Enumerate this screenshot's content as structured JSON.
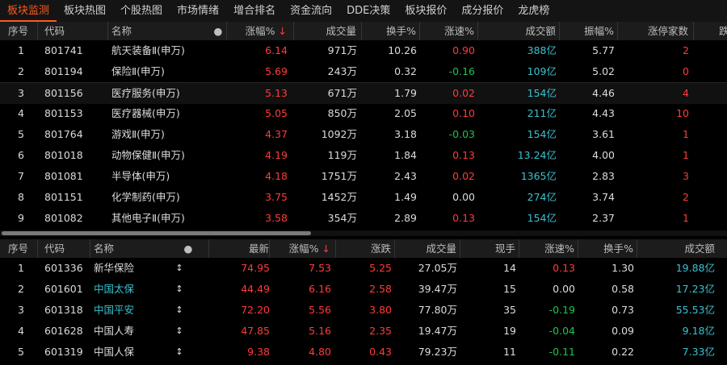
{
  "tabs": [
    {
      "label": "板块监测",
      "active": true
    },
    {
      "label": "板块热图",
      "active": false
    },
    {
      "label": "个股热图",
      "active": false
    },
    {
      "label": "市场情绪",
      "active": false
    },
    {
      "label": "增合排名",
      "active": false
    },
    {
      "label": "资金流向",
      "active": false
    },
    {
      "label": "DDE决策",
      "active": false
    },
    {
      "label": "板块报价",
      "active": false
    },
    {
      "label": "成分报价",
      "active": false
    },
    {
      "label": "龙虎榜",
      "active": false
    }
  ],
  "sector_table": {
    "headers": {
      "no": "序号",
      "code": "代码",
      "name": "名称",
      "change_pct": "涨幅%",
      "sort_arrow": "↓",
      "volume": "成交量",
      "turnover": "换手%",
      "speed": "涨速%",
      "amount": "成交额",
      "amplitude": "振幅%",
      "limit_up": "涨停家数",
      "cut": "跌"
    },
    "rows": [
      {
        "no": "1",
        "code": "801741",
        "name": "航天装备Ⅱ(申万)",
        "change": "6.14",
        "volume": "971万",
        "turnover": "10.26",
        "speed": "0.90",
        "speed_color": "red",
        "amount": "388亿",
        "amplitude": "5.77",
        "limit_up": "2"
      },
      {
        "no": "2",
        "code": "801194",
        "name": "保险Ⅱ(申万)",
        "change": "5.69",
        "volume": "243万",
        "turnover": "0.32",
        "speed": "-0.16",
        "speed_color": "green",
        "amount": "109亿",
        "amplitude": "5.02",
        "limit_up": "0"
      },
      {
        "no": "3",
        "code": "801156",
        "name": "医疗服务(申万)",
        "change": "5.13",
        "volume": "671万",
        "turnover": "1.79",
        "speed": "0.02",
        "speed_color": "red",
        "amount": "154亿",
        "amplitude": "4.46",
        "limit_up": "4"
      },
      {
        "no": "4",
        "code": "801153",
        "name": "医疗器械(申万)",
        "change": "5.05",
        "volume": "850万",
        "turnover": "2.05",
        "speed": "0.10",
        "speed_color": "red",
        "amount": "211亿",
        "amplitude": "4.43",
        "limit_up": "10"
      },
      {
        "no": "5",
        "code": "801764",
        "name": "游戏Ⅱ(申万)",
        "change": "4.37",
        "volume": "1092万",
        "turnover": "3.18",
        "speed": "-0.03",
        "speed_color": "green",
        "amount": "154亿",
        "amplitude": "3.61",
        "limit_up": "1"
      },
      {
        "no": "6",
        "code": "801018",
        "name": "动物保健Ⅱ(申万)",
        "change": "4.19",
        "volume": "119万",
        "turnover": "1.84",
        "speed": "0.13",
        "speed_color": "red",
        "amount": "13.24亿",
        "amplitude": "4.00",
        "limit_up": "1"
      },
      {
        "no": "7",
        "code": "801081",
        "name": "半导体(申万)",
        "change": "4.18",
        "volume": "1751万",
        "turnover": "2.43",
        "speed": "0.02",
        "speed_color": "red",
        "amount": "1365亿",
        "amplitude": "2.83",
        "limit_up": "3"
      },
      {
        "no": "8",
        "code": "801151",
        "name": "化学制药(申万)",
        "change": "3.75",
        "volume": "1452万",
        "turnover": "1.49",
        "speed": "0.00",
        "speed_color": "white",
        "amount": "274亿",
        "amplitude": "3.74",
        "limit_up": "2"
      },
      {
        "no": "9",
        "code": "801082",
        "name": "其他电子Ⅱ(申万)",
        "change": "3.58",
        "volume": "354万",
        "turnover": "2.89",
        "speed": "0.13",
        "speed_color": "red",
        "amount": "154亿",
        "amplitude": "2.37",
        "limit_up": "1"
      }
    ]
  },
  "stock_table": {
    "headers": {
      "no": "序号",
      "code": "代码",
      "name": "名称",
      "last": "最新",
      "change_pct": "涨幅%",
      "sort_arrow": "↓",
      "change": "涨跌",
      "volume": "成交量",
      "hand": "现手",
      "speed": "涨速%",
      "turnover": "换手%",
      "amount": "成交额"
    },
    "rows": [
      {
        "no": "1",
        "code": "601336",
        "name": "新华保险",
        "name_color": "white",
        "last": "74.95",
        "pct": "7.53",
        "chg": "5.25",
        "volume": "27.05万",
        "hand": "14",
        "speed": "0.13",
        "speed_color": "red",
        "turnover": "1.30",
        "amount": "19.88亿"
      },
      {
        "no": "2",
        "code": "601601",
        "name": "中国太保",
        "name_color": "cyan",
        "last": "44.49",
        "pct": "6.16",
        "chg": "2.58",
        "volume": "39.47万",
        "hand": "15",
        "speed": "0.00",
        "speed_color": "white",
        "turnover": "0.58",
        "amount": "17.23亿"
      },
      {
        "no": "3",
        "code": "601318",
        "name": "中国平安",
        "name_color": "cyan",
        "last": "72.20",
        "pct": "5.56",
        "chg": "3.80",
        "volume": "77.80万",
        "hand": "35",
        "speed": "-0.19",
        "speed_color": "green",
        "turnover": "0.73",
        "amount": "55.53亿"
      },
      {
        "no": "4",
        "code": "601628",
        "name": "中国人寿",
        "name_color": "white",
        "last": "47.85",
        "pct": "5.16",
        "chg": "2.35",
        "volume": "19.47万",
        "hand": "19",
        "speed": "-0.04",
        "speed_color": "green",
        "turnover": "0.09",
        "amount": "9.18亿"
      },
      {
        "no": "5",
        "code": "601319",
        "name": "中国人保",
        "name_color": "white",
        "last": "9.38",
        "pct": "4.80",
        "chg": "0.43",
        "volume": "79.23万",
        "hand": "11",
        "speed": "-0.11",
        "speed_color": "green",
        "turnover": "0.22",
        "amount": "7.33亿"
      }
    ]
  },
  "colors": {
    "up": "#ff3b3b",
    "down": "#1fc34a",
    "amount": "#39c2cf",
    "accent": "#ff5a1f"
  }
}
